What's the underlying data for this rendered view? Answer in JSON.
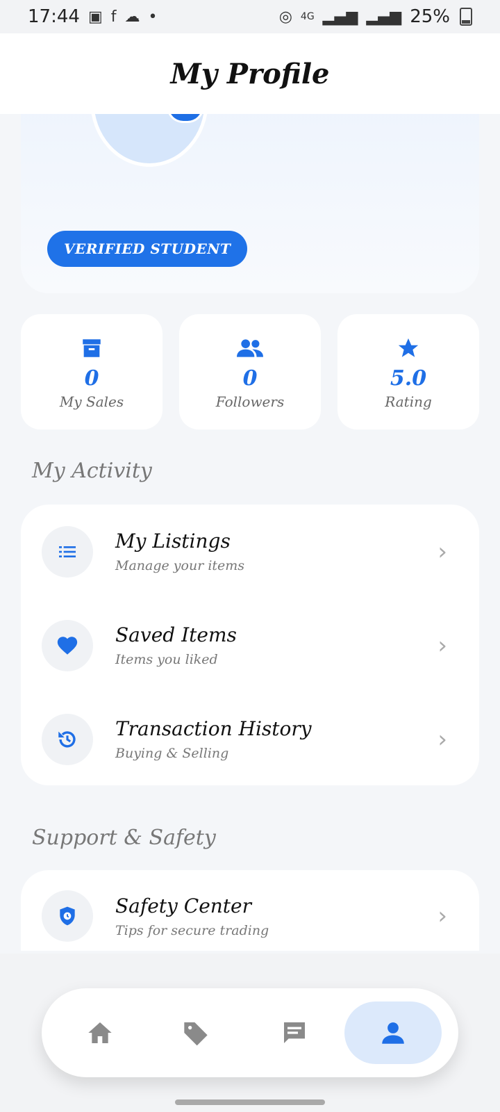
{
  "status": {
    "time": "17:44",
    "network": "4G",
    "battery": "25%"
  },
  "header": {
    "title": "My Profile"
  },
  "profile": {
    "badge": "VERIFIED STUDENT"
  },
  "stats": [
    {
      "icon": "archive-icon",
      "value": "0",
      "label": "My Sales"
    },
    {
      "icon": "group-icon",
      "value": "0",
      "label": "Followers"
    },
    {
      "icon": "star-icon",
      "value": "5.0",
      "label": "Rating"
    }
  ],
  "activity": {
    "title": "My Activity",
    "items": [
      {
        "icon": "list-icon",
        "title": "My Listings",
        "subtitle": "Manage your items"
      },
      {
        "icon": "heart-icon",
        "title": "Saved Items",
        "subtitle": "Items you liked"
      },
      {
        "icon": "history-icon",
        "title": "Transaction History",
        "subtitle": "Buying & Selling"
      }
    ]
  },
  "support": {
    "title": "Support & Safety",
    "items": [
      {
        "icon": "shield-icon",
        "title": "Safety Center",
        "subtitle": "Tips for secure trading"
      }
    ]
  },
  "nav": [
    {
      "icon": "home-icon",
      "active": false
    },
    {
      "icon": "tag-icon",
      "active": false
    },
    {
      "icon": "chat-icon",
      "active": false
    },
    {
      "icon": "person-icon",
      "active": true
    }
  ],
  "colors": {
    "accent": "#1f6fe6",
    "badge": "#1f72e8",
    "muted": "#777777"
  }
}
